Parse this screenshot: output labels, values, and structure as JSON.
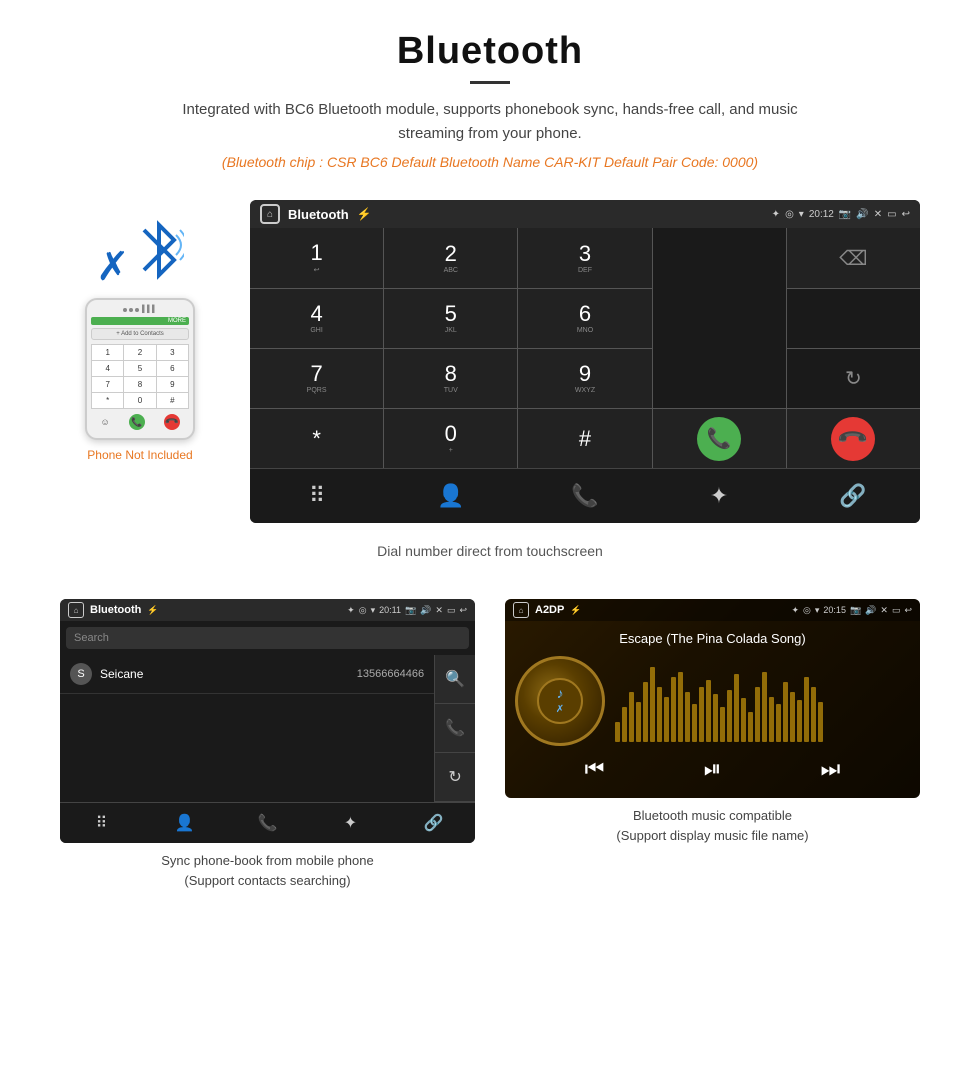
{
  "header": {
    "title": "Bluetooth",
    "subtitle": "Integrated with BC6 Bluetooth module, supports phonebook sync, hands-free call, and music streaming from your phone.",
    "specs": "(Bluetooth chip : CSR BC6    Default Bluetooth Name CAR-KIT    Default Pair Code: 0000)"
  },
  "phone_side": {
    "not_included": "Phone Not Included"
  },
  "dial_screen": {
    "status_bar": {
      "title": "Bluetooth",
      "time": "20:12"
    },
    "keys": [
      {
        "num": "1",
        "sub": "↩"
      },
      {
        "num": "2",
        "sub": "ABC"
      },
      {
        "num": "3",
        "sub": "DEF"
      },
      {
        "num": "4",
        "sub": "GHI"
      },
      {
        "num": "5",
        "sub": "JKL"
      },
      {
        "num": "6",
        "sub": "MNO"
      },
      {
        "num": "7",
        "sub": "PQRS"
      },
      {
        "num": "8",
        "sub": "TUV"
      },
      {
        "num": "9",
        "sub": "WXYZ"
      },
      {
        "num": "*",
        "sub": ""
      },
      {
        "num": "0",
        "sub": "+"
      },
      {
        "num": "#",
        "sub": ""
      }
    ],
    "caption": "Dial number direct from touchscreen"
  },
  "phonebook_screen": {
    "status_bar": {
      "title": "Bluetooth",
      "time": "20:11"
    },
    "search_placeholder": "Search",
    "contacts": [
      {
        "letter": "S",
        "name": "Seicane",
        "number": "13566664466"
      }
    ],
    "caption": "Sync phone-book from mobile phone\n(Support contacts searching)"
  },
  "music_screen": {
    "status_bar": {
      "title": "A2DP",
      "time": "20:15"
    },
    "song_title": "Escape (The Pina Colada Song)",
    "caption": "Bluetooth music compatible\n(Support display music file name)",
    "viz_heights": [
      20,
      35,
      50,
      40,
      60,
      75,
      55,
      45,
      65,
      70,
      50,
      38,
      55,
      62,
      48,
      35,
      52,
      68,
      44,
      30,
      55,
      70,
      45,
      38,
      60,
      50,
      42,
      65,
      55,
      40
    ]
  }
}
